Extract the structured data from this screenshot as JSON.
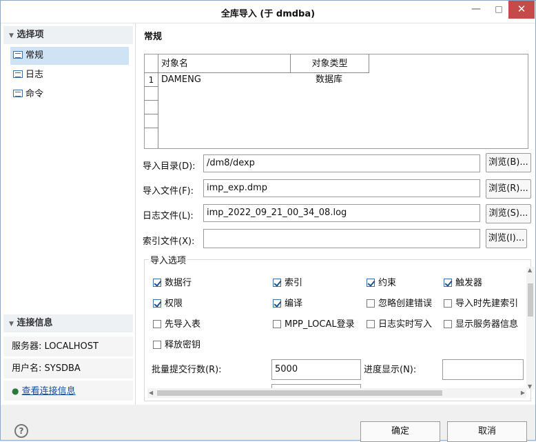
{
  "window": {
    "title": "全库导入 (于 dmdba)",
    "minimize": "—",
    "maximize": "□",
    "close": "✕"
  },
  "sidebar": {
    "section_title": "选择项",
    "items": [
      {
        "label": "常规"
      },
      {
        "label": "日志"
      },
      {
        "label": "命令"
      }
    ],
    "conn_title": "连接信息",
    "server": "服务器: LOCALHOST",
    "user": "用户名: SYSDBA",
    "view_link": "查看连接信息"
  },
  "main": {
    "title": "常规",
    "table": {
      "headers": [
        "对象名",
        "对象类型"
      ],
      "rows": [
        {
          "num": "1",
          "name": "DAMENG",
          "type": "数据库"
        }
      ]
    },
    "fields": {
      "dir": {
        "label": "导入目录(D):",
        "value": "/dm8/dexp",
        "button": "浏览(B)..."
      },
      "file": {
        "label": "导入文件(F):",
        "value": "imp_exp.dmp",
        "button": "浏览(R)..."
      },
      "log": {
        "label": "日志文件(L):",
        "value": "imp_2022_09_21_00_34_08.log",
        "button": "浏览(S)..."
      },
      "index": {
        "label": "索引文件(X):",
        "value": "",
        "button": "浏览(I)..."
      }
    },
    "options": {
      "title": "导入选项",
      "checks": [
        {
          "label": "数据行",
          "checked": true
        },
        {
          "label": "索引",
          "checked": true
        },
        {
          "label": "约束",
          "checked": true
        },
        {
          "label": "触发器",
          "checked": true
        },
        {
          "label": "权限",
          "checked": true
        },
        {
          "label": "编译",
          "checked": true
        },
        {
          "label": "忽略创建错误",
          "checked": false
        },
        {
          "label": "导入时先建索引",
          "checked": false
        },
        {
          "label": "先导入表",
          "checked": false
        },
        {
          "label": "MPP_LOCAL登录",
          "checked": false
        },
        {
          "label": "日志实时写入",
          "checked": false
        },
        {
          "label": "显示服务器信息",
          "checked": false
        },
        {
          "label": "释放密钥",
          "checked": false
        }
      ],
      "batch_label": "批量提交行数(R):",
      "batch_value": "5000",
      "progress_label": "进度显示(N):",
      "progress_value": ""
    }
  },
  "footer": {
    "help": "?",
    "ok": "确定",
    "cancel": "取消"
  }
}
